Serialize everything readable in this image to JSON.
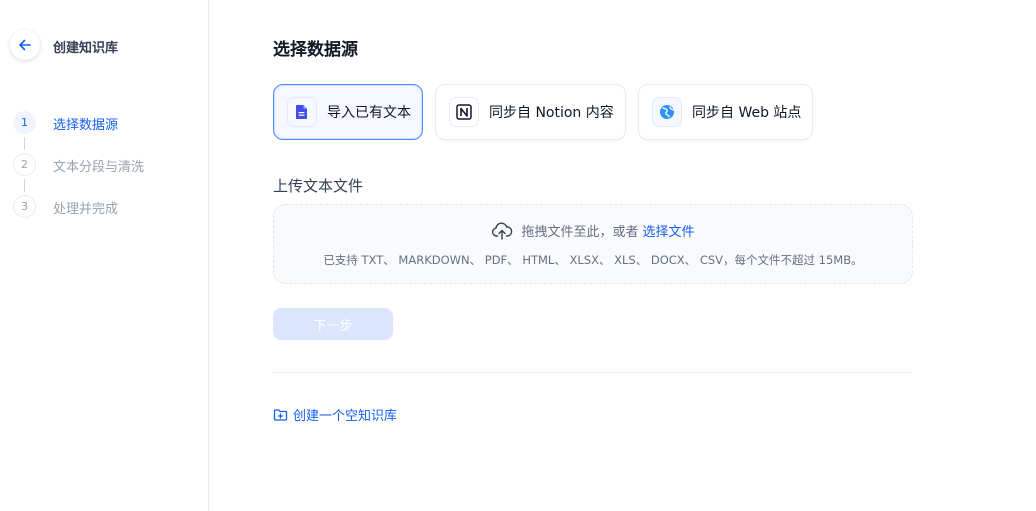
{
  "sidebar": {
    "title": "创建知识库",
    "steps": [
      {
        "num": "1",
        "label": "选择数据源"
      },
      {
        "num": "2",
        "label": "文本分段与清洗"
      },
      {
        "num": "3",
        "label": "处理并完成"
      }
    ]
  },
  "main": {
    "title": "选择数据源",
    "sources": [
      {
        "label": "导入已有文本",
        "icon": "document-icon"
      },
      {
        "label": "同步自 Notion 内容",
        "icon": "notion-icon"
      },
      {
        "label": "同步自 Web 站点",
        "icon": "web-icon"
      }
    ],
    "upload": {
      "title": "上传文本文件",
      "drop_text": "拖拽文件至此，或者",
      "pick_text": "选择文件",
      "support_text": "已支持 TXT、 MARKDOWN、 PDF、 HTML、 XLSX、 XLS、 DOCX、 CSV，每个文件不超过 15MB。"
    },
    "next_label": "下一步",
    "create_empty_label": "创建一个空知识库"
  },
  "colors": {
    "accent": "#155eef",
    "selected_bg": "#f5f8ff",
    "disabled_button": "#dbe6fe"
  }
}
